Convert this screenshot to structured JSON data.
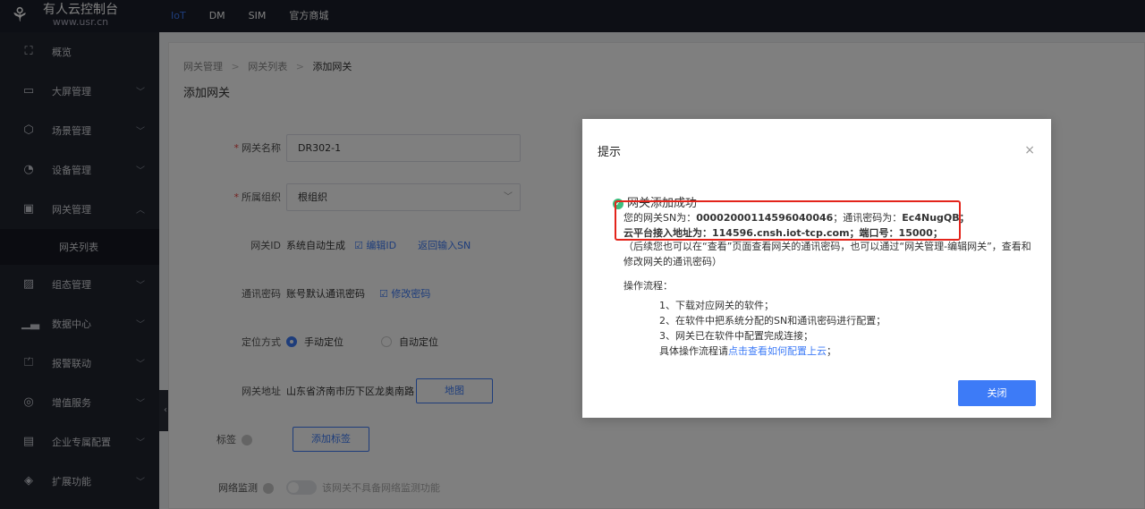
{
  "brand": {
    "title": "有人云控制台",
    "url": "www.usr.cn",
    "logo_icon": "usr-logo-icon"
  },
  "topnav": [
    {
      "label": "IoT",
      "active": true
    },
    {
      "label": "DM",
      "active": false
    },
    {
      "label": "SIM",
      "active": false
    },
    {
      "label": "官方商城",
      "active": false
    }
  ],
  "sidebar": {
    "items": [
      {
        "label": "概览",
        "icon": "overview-icon",
        "glyph": "⛶"
      },
      {
        "label": "大屏管理",
        "icon": "screen-icon",
        "glyph": "▭"
      },
      {
        "label": "场景管理",
        "icon": "cube-icon",
        "glyph": "⬡"
      },
      {
        "label": "设备管理",
        "icon": "pie-chart-icon",
        "glyph": "◔"
      },
      {
        "label": "网关管理",
        "icon": "gateway-icon",
        "glyph": "▣"
      },
      {
        "label": "网关列表",
        "icon": "",
        "glyph": ""
      },
      {
        "label": "组态管理",
        "icon": "image-icon",
        "glyph": "▨"
      },
      {
        "label": "数据中心",
        "icon": "bar-chart-icon",
        "glyph": "▁▃"
      },
      {
        "label": "报警联动",
        "icon": "alarm-icon",
        "glyph": "⏍"
      },
      {
        "label": "增值服务",
        "icon": "coin-icon",
        "glyph": "◎"
      },
      {
        "label": "企业专属配置",
        "icon": "enterprise-icon",
        "glyph": "▤"
      },
      {
        "label": "扩展功能",
        "icon": "layers-icon",
        "glyph": "◈"
      }
    ],
    "collapse_glyph": "‹"
  },
  "breadcrumb": {
    "level1": "网关管理",
    "level2": "网关列表",
    "current": "添加网关",
    "separator": ">"
  },
  "page_title": "添加网关",
  "form": {
    "name_label": "网关名称",
    "name_value": "DR302-1",
    "org_label": "所属组织",
    "org_value": "根组织",
    "id_label": "网关ID",
    "id_text": "系统自动生成",
    "id_edit_link": "☑ 编辑ID",
    "id_back_link": "返回输入SN",
    "pwd_label": "通讯密码",
    "pwd_text": "账号默认通讯密码",
    "pwd_edit_link": "☑ 修改密码",
    "loc_label": "定位方式",
    "loc_manual": "手动定位",
    "loc_auto": "自动定位",
    "addr_label": "网关地址",
    "addr_value": "山东省济南市历下区龙奥南路",
    "addr_map_btn": "地图",
    "tag_label": "标签",
    "tag_btn": "添加标签",
    "net_label": "网络监测",
    "net_hint": "该网关不具备网络监测功能"
  },
  "dialog": {
    "title": "提示",
    "close_glyph": "×",
    "success": "网关添加成功",
    "sn_prefix": "您的网关SN为：",
    "sn_value": "00002000114596040046",
    "pwd_prefix": "；通讯密码为：",
    "pwd_value": "Ec4NugQB",
    "pwd_suffix": "；",
    "addr_prefix": "云平台接入地址为：",
    "addr_value": "114596.cnsh.iot-tcp.com",
    "port_prefix": "；端口号：",
    "port_value": "15000",
    "port_suffix": "；",
    "note": "（后续您也可以在“查看”页面查看网关的通讯密码，也可以通过“网关管理-编辑网关”，查看和修改网关的通讯密码）",
    "steps_title": "操作流程：",
    "steps": [
      "1、下载对应网关的软件；",
      "2、在软件中把系统分配的SN和通讯密码进行配置；",
      "3、网关已在软件中配置完成连接；"
    ],
    "help_prefix": "具体操作流程请",
    "help_link": "点击查看如何配置上云",
    "help_suffix": "；",
    "close_btn": "关闭"
  },
  "colors": {
    "accent": "#3d7bf7",
    "highlight": "#e3241b",
    "success": "#3dbd7d",
    "sidebar_bg": "#20242f"
  }
}
